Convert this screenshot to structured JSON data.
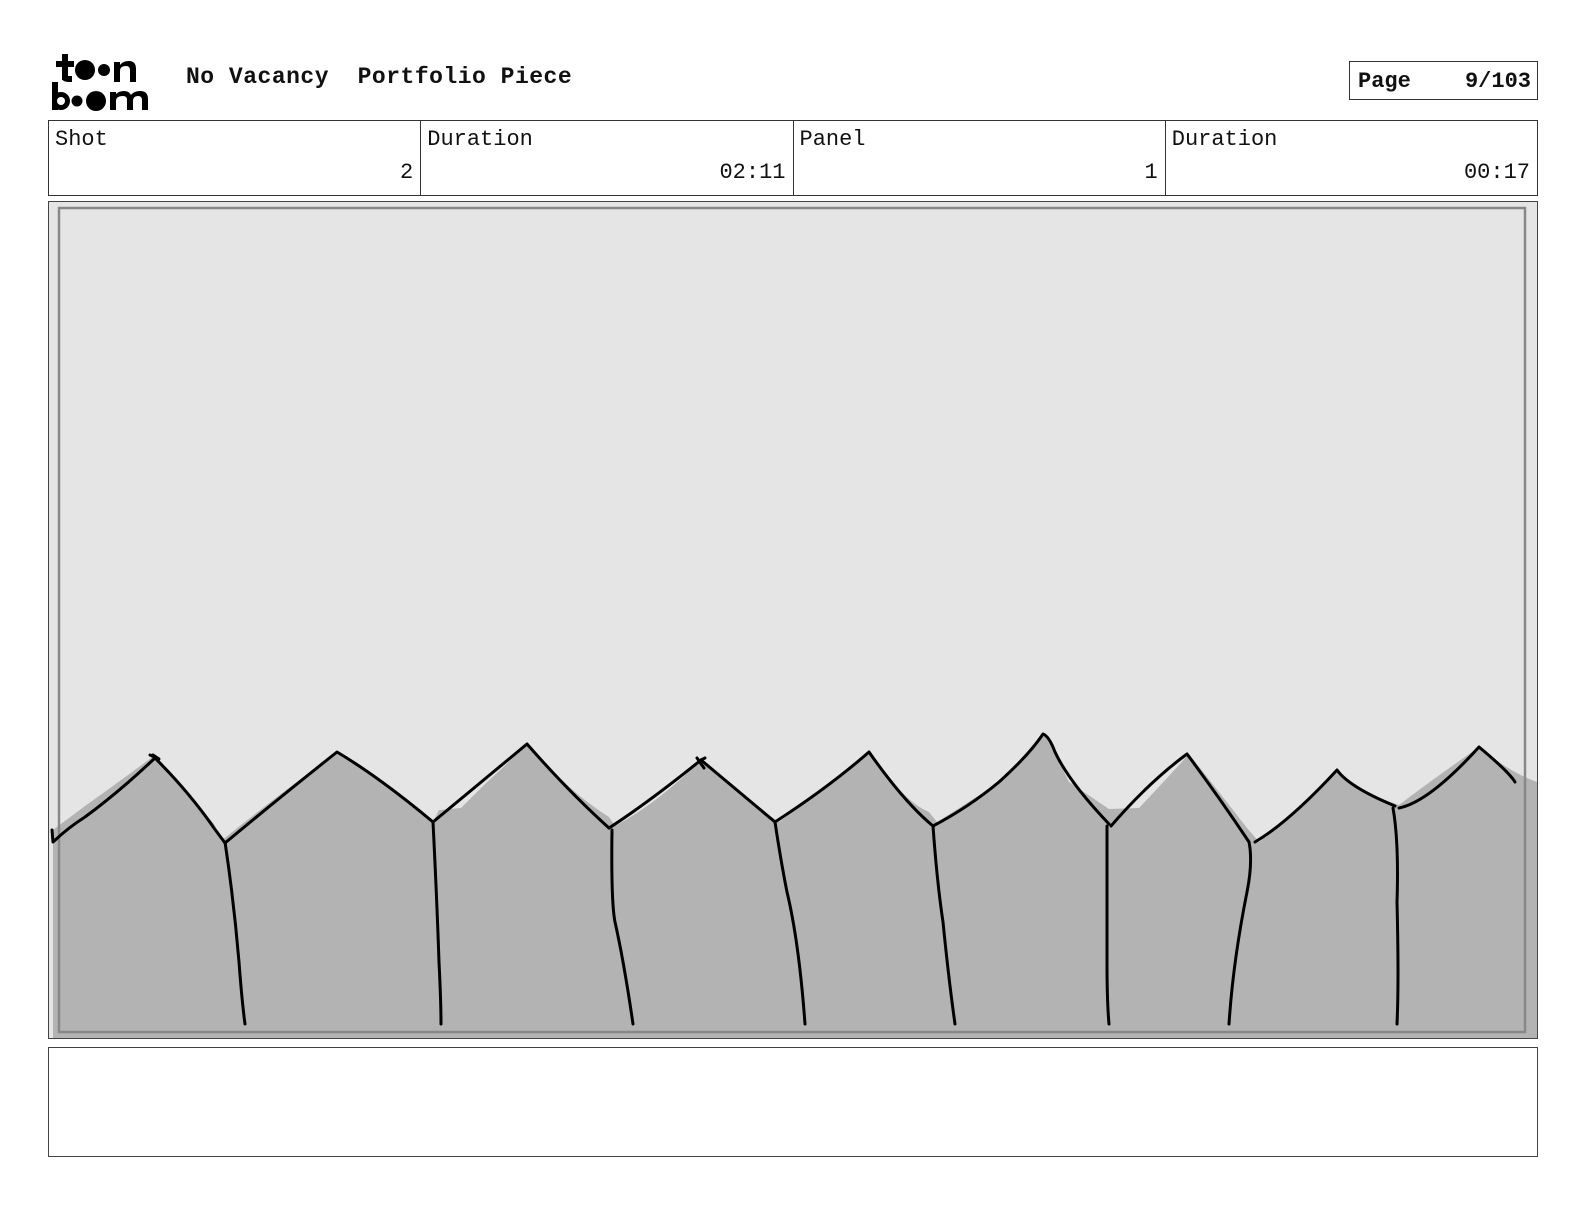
{
  "header": {
    "logo_text": "toon boom",
    "project_title": "No Vacancy  Portfolio Piece",
    "page_label": "Page",
    "page_value": "9/103"
  },
  "info": {
    "shot_label": "Shot",
    "shot_value": "2",
    "shot_duration_label": "Duration",
    "shot_duration_value": "02:11",
    "panel_label": "Panel",
    "panel_value": "1",
    "panel_duration_label": "Duration",
    "panel_duration_value": "00:17"
  },
  "panel_image": {
    "description_icon": "picket-fence-sketch",
    "colors": {
      "sky": "#e5e5e5",
      "fence": "#b3b3b3",
      "ink": "#000000"
    }
  },
  "notes": {
    "text": ""
  }
}
